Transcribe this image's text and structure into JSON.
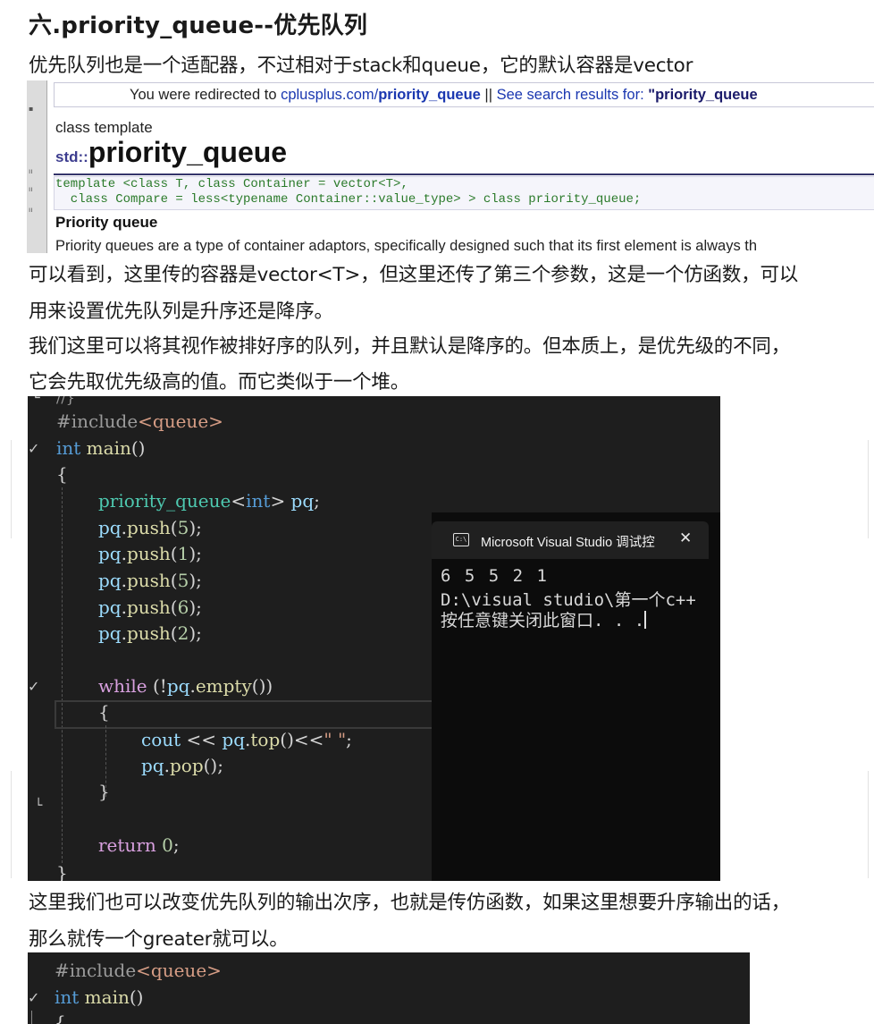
{
  "heading": "六.priority_queue--优先队列",
  "intro": "优先队列也是一个适配器，不过相对于stack和queue，它的默认容器是vector",
  "reference": {
    "redirect_prefix": "You were redirected to ",
    "redirect_link_host": "cplusplus.com/",
    "redirect_link_path": "priority_queue",
    "redirect_sep": " || ",
    "redirect_search": "See search results for: ",
    "redirect_query": "\"priority_queue",
    "kind": "class template",
    "namespace": "std::",
    "name": "priority_queue",
    "decl_line1": "template <class T, class Container = vector<T>,",
    "decl_line2": "  class Compare = less<typename Container::value_type> > class priority_queue;",
    "subhead": "Priority queue",
    "desc": "Priority queues are a type of container adaptors, specifically designed such that its first element is always th"
  },
  "para1_line1": "可以看到，这里传的容器是vector<T>，但这里还传了第三个参数，这是一个仿函数，可以",
  "para1_line2": "用来设置优先队列是升序还是降序。",
  "para2_line1": "我们这里可以将其视作被排好序的队列，并且默认是降序的。但本质上，是优先级的不同，",
  "para2_line2": "它会先取优先级高的值。而它类似于一个堆。",
  "code1": {
    "top_fragment": "//}",
    "include_dir": "#include",
    "include_hdr": "<queue>",
    "int_kw": "int",
    "main_fn": " main",
    "parens": "()",
    "open_brace": "{",
    "pq_type": "priority_queue",
    "pq_tmpl_open": "<",
    "pq_tmpl_int": "int",
    "pq_tmpl_close": ">",
    "pq_var": " pq",
    "semicolon": ";",
    "push_lines": [
      {
        "obj": "pq",
        "dot": ".",
        "fn": "push",
        "open": "(",
        "arg": "5",
        "close": ");"
      },
      {
        "obj": "pq",
        "dot": ".",
        "fn": "push",
        "open": "(",
        "arg": "1",
        "close": ");"
      },
      {
        "obj": "pq",
        "dot": ".",
        "fn": "push",
        "open": "(",
        "arg": "5",
        "close": ");"
      },
      {
        "obj": "pq",
        "dot": ".",
        "fn": "push",
        "open": "(",
        "arg": "6",
        "close": ");"
      },
      {
        "obj": "pq",
        "dot": ".",
        "fn": "push",
        "open": "(",
        "arg": "2",
        "close": ");"
      }
    ],
    "while_kw": "while",
    "while_open": " (!",
    "while_obj": "pq",
    "while_dot": ".",
    "while_fn": "empty",
    "while_close": "())",
    "inner_open": "{",
    "cout": "cout",
    "cout_op": " << ",
    "cout_obj": "pq",
    "cout_dot": ".",
    "cout_fn": "top",
    "cout_rest": "()<<",
    "cout_str": "\" \"",
    "cout_semi": ";",
    "pop_obj": "pq",
    "pop_dot": ".",
    "pop_fn": "pop",
    "pop_rest": "();",
    "inner_close": "}",
    "return_kw": "return",
    "return_val": " 0",
    "return_semi": ";",
    "close_brace": "}"
  },
  "console": {
    "title": "Microsoft Visual Studio 调试控",
    "icon_text": "C:\\",
    "close": "✕",
    "output": "6 5 5 2 1",
    "path": "D:\\visual studio\\第一个c++",
    "prompt": "按任意键关闭此窗口. . ."
  },
  "para3_line1": "这里我们也可以改变优先队列的输出次序，也就是传仿函数，如果这里想要升序输出的话，",
  "para3_line2": "那么就传一个greater就可以。",
  "code2": {
    "include_dir": "#include",
    "include_hdr": "<queue>",
    "int_kw": "int",
    "main_fn": " main",
    "parens": "()",
    "open_brace": "{"
  }
}
